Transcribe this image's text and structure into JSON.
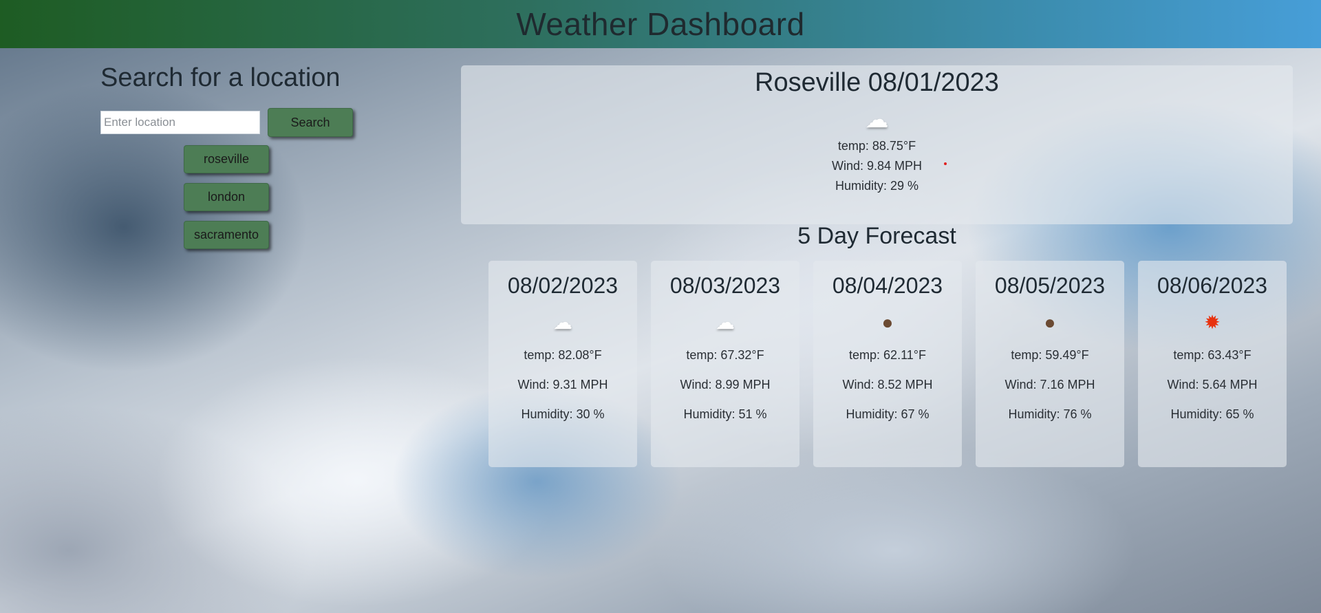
{
  "header": {
    "title": "Weather Dashboard"
  },
  "search": {
    "title": "Search for a location",
    "placeholder": "Enter location",
    "button_label": "Search",
    "history": [
      {
        "label": "roseville"
      },
      {
        "label": "london"
      },
      {
        "label": "sacramento"
      }
    ]
  },
  "current": {
    "title": "Roseville 08/01/2023",
    "icon": "cloud-icon",
    "temp": "temp: 88.75°F",
    "wind": "Wind: 9.84 MPH",
    "humidity": "Humidity: 29 %"
  },
  "forecast": {
    "title": "5 Day Forecast",
    "days": [
      {
        "date": "08/02/2023",
        "icon": "cloud-icon",
        "temp": "temp: 82.08°F",
        "wind": "Wind: 9.31 MPH",
        "humidity": "Humidity: 30 %"
      },
      {
        "date": "08/03/2023",
        "icon": "cloud-icon",
        "temp": "temp: 67.32°F",
        "wind": "Wind: 8.99 MPH",
        "humidity": "Humidity: 51 %"
      },
      {
        "date": "08/04/2023",
        "icon": "rain-drop-icon",
        "temp": "temp: 62.11°F",
        "wind": "Wind: 8.52 MPH",
        "humidity": "Humidity: 67 %"
      },
      {
        "date": "08/05/2023",
        "icon": "rain-drop-icon",
        "temp": "temp: 59.49°F",
        "wind": "Wind: 7.16 MPH",
        "humidity": "Humidity: 76 %"
      },
      {
        "date": "08/06/2023",
        "icon": "sun-icon",
        "temp": "temp: 63.43°F",
        "wind": "Wind: 5.64 MPH",
        "humidity": "Humidity: 65 %"
      }
    ]
  },
  "colors": {
    "header_start": "#1e5c23",
    "header_end": "#479ed8",
    "button": "#4d7d55"
  }
}
